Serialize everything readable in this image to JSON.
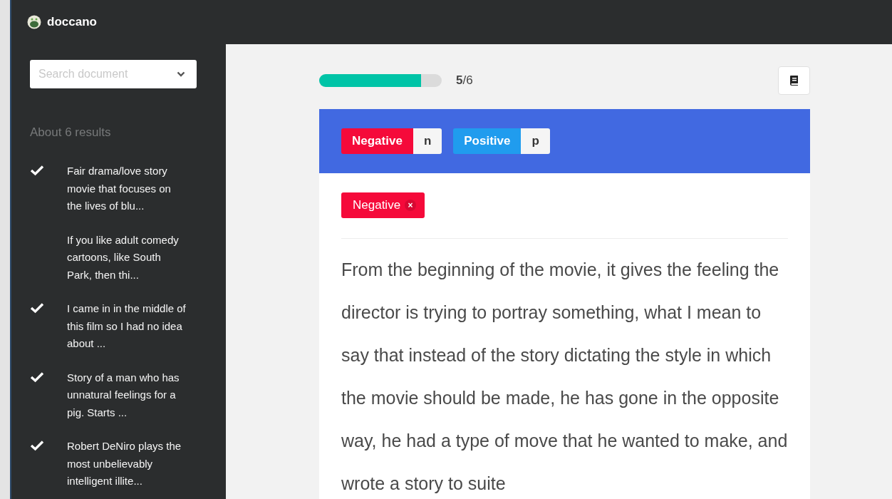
{
  "app": {
    "name": "doccano"
  },
  "sidebar": {
    "search": {
      "placeholder": "Search document"
    },
    "result_count": "About 6 results",
    "items": [
      {
        "text": "Fair drama/love story movie that focuses on the lives of blu...",
        "checked": true
      },
      {
        "text": "If you like adult comedy cartoons, like South Park, then thi...",
        "checked": false
      },
      {
        "text": "I came in in the middle of this film so I had no idea about ...",
        "checked": true
      },
      {
        "text": "Story of a man who has unnatural feelings for a pig. Starts ...",
        "checked": true
      },
      {
        "text": "Robert DeNiro plays the most unbelievably intelligent illite...",
        "checked": true
      }
    ]
  },
  "progress": {
    "level": 0.83,
    "reading": "**5**/6"
  },
  "labels": [
    {
      "name": "Negative",
      "shortcut": "n",
      "color": "#f50a3a"
    },
    {
      "name": "Positive",
      "shortcut": "p",
      "color": "#209cee"
    }
  ],
  "annotations": [
    {
      "name": "Negative",
      "remove": "×",
      "color": "#f50a3a"
    }
  ],
  "document": {
    "text": "From the beginning of the movie, it gives the feeling the director is trying to portray something, what I mean to say that instead of the story dictating the style in which the movie should be made, he has gone in the opposite way, he had a type of move that he wanted to make, and wrote a story to suite"
  }
}
